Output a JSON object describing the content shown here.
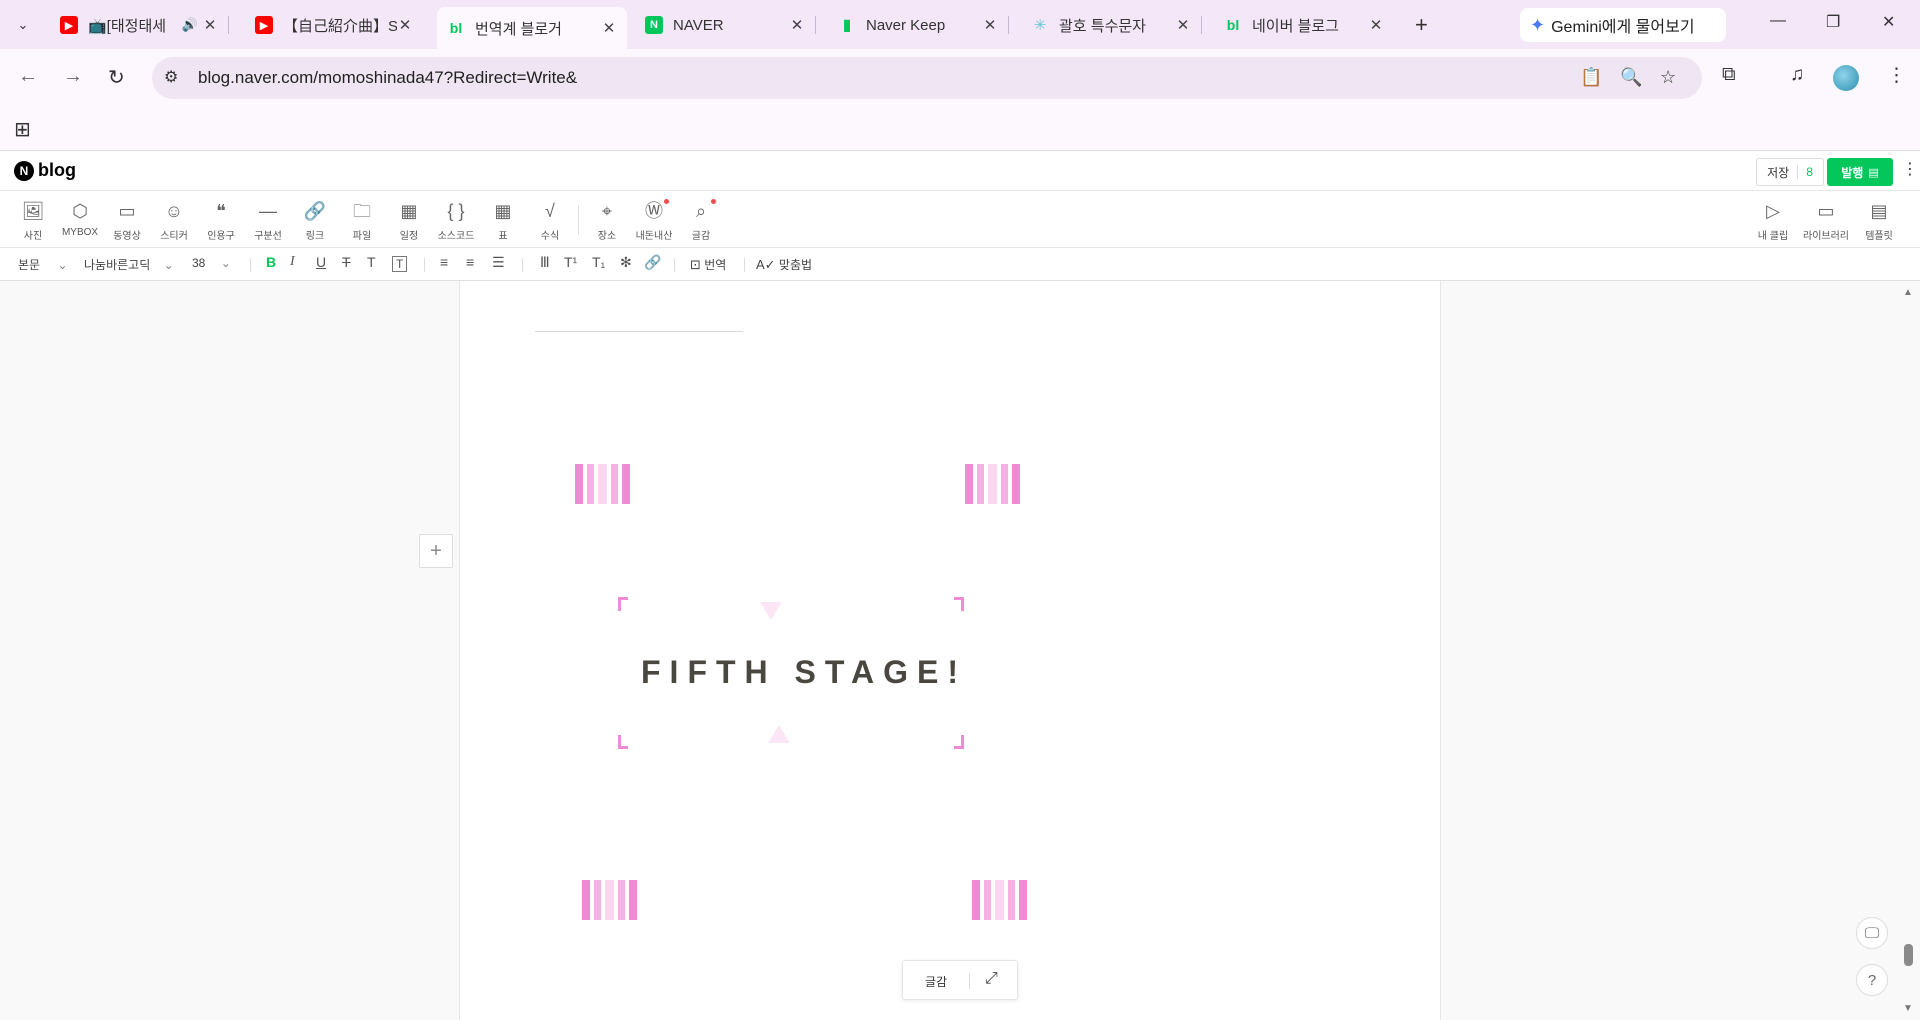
{
  "browser": {
    "tabs": [
      {
        "label": "📺[태정태세",
        "favicon": "youtube-icon",
        "audio": true,
        "active": false
      },
      {
        "label": "【自己紹介曲】SI",
        "favicon": "youtube-icon",
        "active": false
      },
      {
        "label": "번역계 블로거",
        "favicon": "naver-blog-icon",
        "favicon_text": "bl",
        "active": true
      },
      {
        "label": "NAVER",
        "favicon": "naver-icon",
        "favicon_text": "N",
        "active": false
      },
      {
        "label": "Naver Keep",
        "favicon": "keep-bookmark-icon",
        "active": false
      },
      {
        "label": "괄호 특수문자",
        "favicon": "special-char-icon",
        "active": false
      },
      {
        "label": "네이버 블로그",
        "favicon": "naver-blog-icon",
        "favicon_text": "bl",
        "active": false
      }
    ],
    "gemini_label": "Gemini에게 물어보기",
    "url": "blog.naver.com/momoshinada47?Redirect=Write&"
  },
  "blog": {
    "logo_text": "blog",
    "logo_n": "N",
    "save_label": "저장",
    "save_count": "8",
    "publish_label": "발행"
  },
  "insert_toolbar": {
    "items": [
      {
        "label": "사진",
        "icon": "photo-icon"
      },
      {
        "label": "MYBOX",
        "icon": "mybox-icon"
      },
      {
        "label": "동영상",
        "icon": "video-icon"
      },
      {
        "label": "스티커",
        "icon": "sticker-icon"
      },
      {
        "label": "인용구",
        "icon": "quote-icon"
      },
      {
        "label": "구분선",
        "icon": "divider-icon"
      },
      {
        "label": "링크",
        "icon": "link-icon"
      },
      {
        "label": "파일",
        "icon": "file-icon"
      },
      {
        "label": "일정",
        "icon": "calendar-icon"
      },
      {
        "label": "소스코드",
        "icon": "source-code-icon"
      },
      {
        "label": "표",
        "icon": "table-icon"
      },
      {
        "label": "수식",
        "icon": "formula-icon"
      },
      {
        "label": "장소",
        "icon": "place-icon"
      },
      {
        "label": "내돈내산",
        "icon": "purchase-icon"
      },
      {
        "label": "글감",
        "icon": "material-search-icon"
      }
    ],
    "right_items": [
      {
        "label": "내 클립",
        "icon": "clip-icon"
      },
      {
        "label": "라이브러리",
        "icon": "library-icon"
      },
      {
        "label": "템플릿",
        "icon": "template-icon"
      }
    ]
  },
  "format_toolbar": {
    "paragraph_style": "본문",
    "font": "나눔바른고딕",
    "font_size": "38",
    "translate_label": "번역",
    "spellcheck_label": "맞춤법"
  },
  "document": {
    "stage_title": "FIFTH STAGE!",
    "accent_color": "#f08ad5"
  },
  "floating_bar": {
    "label": "글감"
  }
}
